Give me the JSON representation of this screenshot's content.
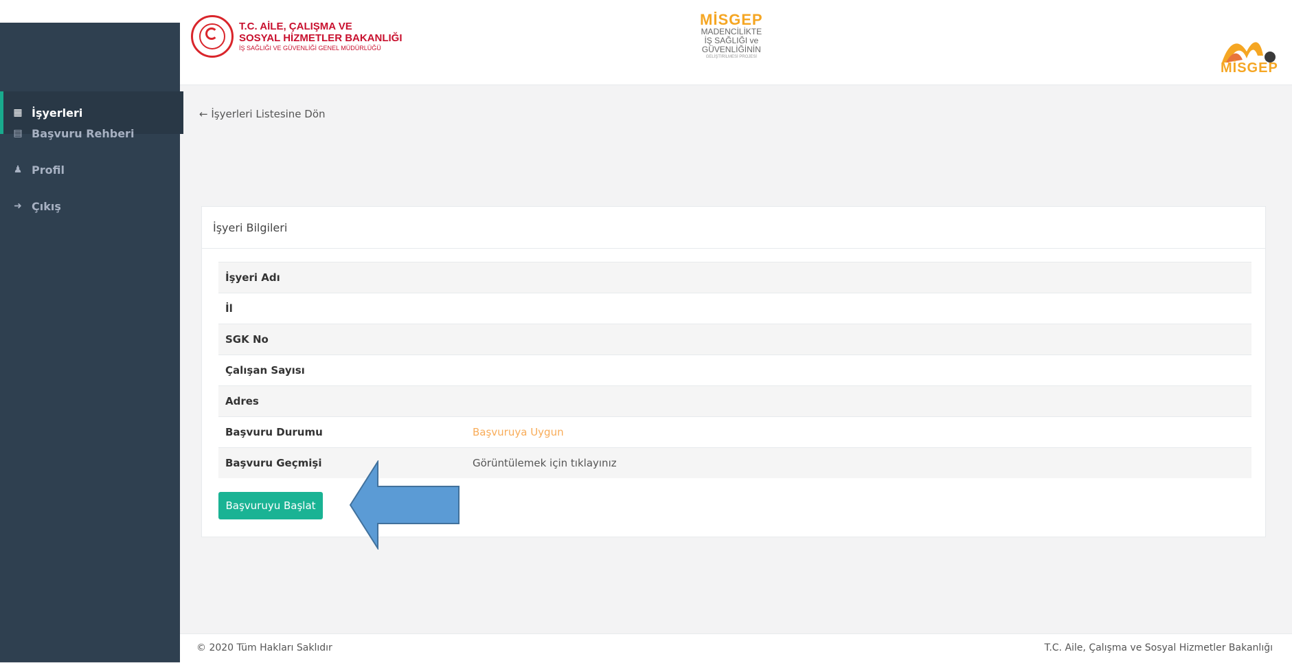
{
  "header": {
    "ministry_line1": "T.C. AİLE, ÇALIŞMA VE",
    "ministry_line2": "SOSYAL HİZMETLER BAKANLIĞI",
    "ministry_line3": "İŞ SAĞLIĞI VE GÜVENLİĞİ GENEL MÜDÜRLÜĞÜ",
    "misgep_title": "MİSGEP",
    "misgep_sub1": "MADENCİLİKTE",
    "misgep_sub2": "İŞ SAĞLIĞI ve",
    "misgep_sub3": "GÜVENLİĞİNİN",
    "misgep_sub4": "GELİŞTİRİLMESİ PROJESİ",
    "misgep_logo_text": "MİSGEP"
  },
  "sidebar": {
    "items": [
      {
        "label": "İşyerleri",
        "icon": "table-icon",
        "active": true
      },
      {
        "label": "Başvuru Rehberi",
        "icon": "file-icon",
        "active": false
      },
      {
        "label": "Profil",
        "icon": "user-icon",
        "active": false
      },
      {
        "label": "Çıkış",
        "icon": "sign-out-icon",
        "active": false
      }
    ]
  },
  "main": {
    "back_link": "İşyerleri Listesine Dön",
    "panel_title": "İşyeri Bilgileri",
    "rows": [
      {
        "label": "İşyeri Adı",
        "value": ""
      },
      {
        "label": "İl",
        "value": ""
      },
      {
        "label": "SGK No",
        "value": ""
      },
      {
        "label": "Çalışan Sayısı",
        "value": ""
      },
      {
        "label": "Adres",
        "value": ""
      },
      {
        "label": "Başvuru Durumu",
        "value": "Başvuruya Uygun"
      },
      {
        "label": "Başvuru Geçmişi",
        "value": "Görüntülemek için tıklayınız"
      }
    ],
    "start_button": "Başvuruyu Başlat"
  },
  "footer": {
    "left": "© 2020 Tüm Hakları Saklıdır",
    "right": "T.C. Aile, Çalışma ve Sosyal Hizmetler Bakanlığı"
  },
  "colors": {
    "sidebar_bg": "#2f4050",
    "accent_green": "#1ab394",
    "status_orange": "#f8ac59",
    "arrow_blue": "#5b9bd5",
    "brand_red": "#c8102e",
    "misgep_orange": "#f5a623"
  }
}
